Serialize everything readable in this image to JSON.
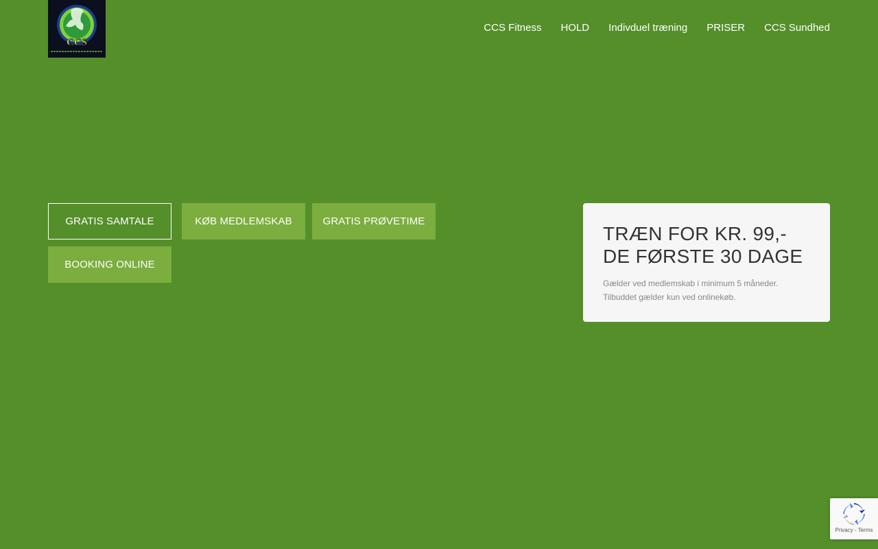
{
  "logo": {
    "text": "CCS",
    "tagline": "Fitness- og Sundhedscenter"
  },
  "nav": {
    "items": [
      {
        "label": "CCS Fitness"
      },
      {
        "label": "HOLD"
      },
      {
        "label": "Indivduel træning"
      },
      {
        "label": "PRISER"
      },
      {
        "label": "CCS Sundhed"
      }
    ]
  },
  "buttons": {
    "gratis_samtale": "GRATIS SAMTALE",
    "kob_medlemskab": "KØB MEDLEMSKAB",
    "gratis_provetime": "GRATIS PRØVETIME",
    "booking_online": "BOOKING ONLINE"
  },
  "offer": {
    "title": "TRÆN FOR KR. 99,- DE FØRSTE 30 DAGE",
    "text": "Gælder ved medlemskab i minimum 5 måneder. Tilbuddet gælder kun ved onlinekøb."
  },
  "recaptcha": {
    "links": "Privacy - Terms",
    "icon": "recaptcha-logo-icon"
  },
  "colors": {
    "background": "#548f2a",
    "button_fill": "#7cad3f",
    "offer_card": "#f6f6f6"
  }
}
